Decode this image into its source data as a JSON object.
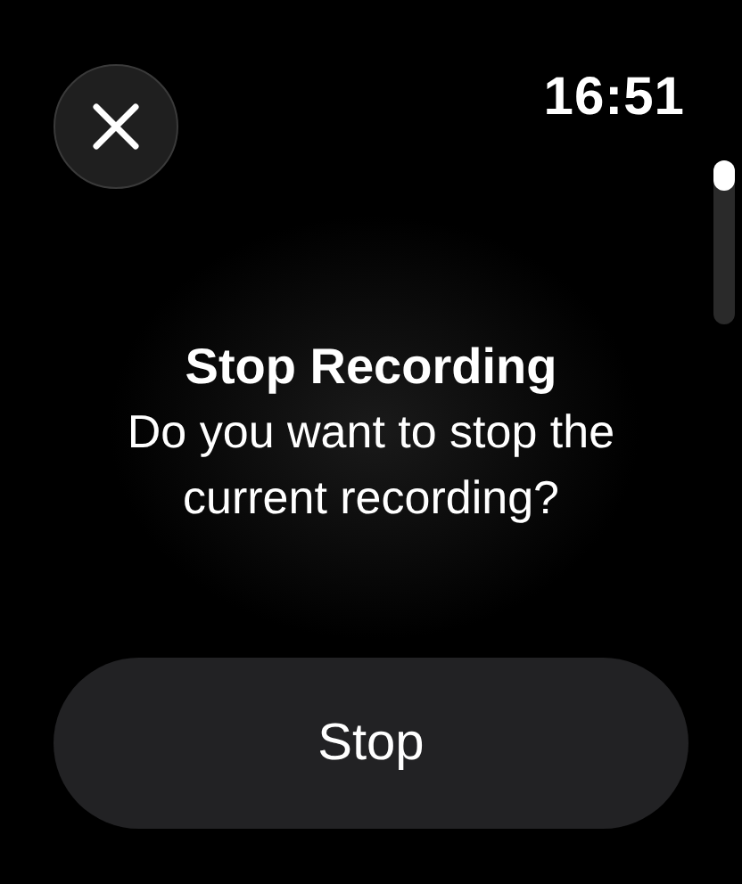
{
  "time": "16:51",
  "alert": {
    "title": "Stop Recording",
    "message": "Do you want to stop the current recording?"
  },
  "button": {
    "label": "Stop"
  }
}
